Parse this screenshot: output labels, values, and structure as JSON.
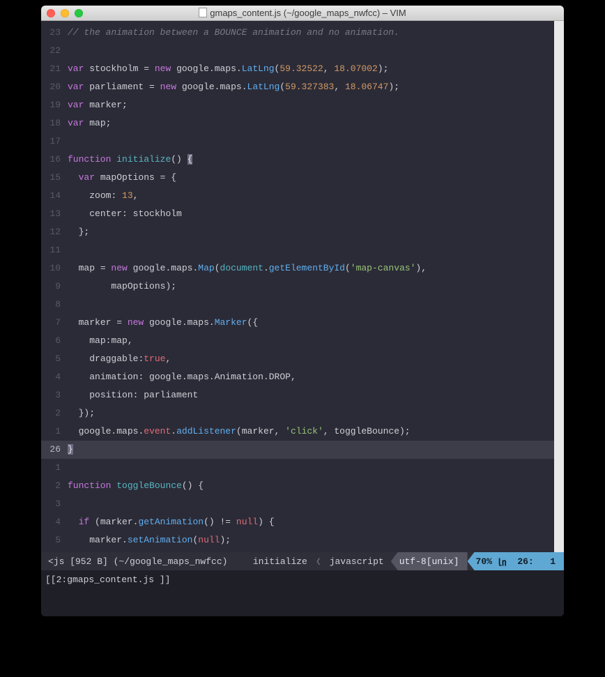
{
  "window": {
    "title": "gmaps_content.js (~/google_maps_nwfcc) – VIM"
  },
  "lines": [
    {
      "n": "23",
      "cur": false,
      "tokens": [
        {
          "c": "comment",
          "t": "// the animation between a BOUNCE animation and no animation."
        }
      ]
    },
    {
      "n": "22",
      "cur": false,
      "tokens": []
    },
    {
      "n": "21",
      "cur": false,
      "tokens": [
        {
          "c": "var",
          "t": "var"
        },
        {
          "c": "op",
          "t": " "
        },
        {
          "c": "ident",
          "t": "stockholm"
        },
        {
          "c": "op",
          "t": " = "
        },
        {
          "c": "new",
          "t": "new"
        },
        {
          "c": "op",
          "t": " "
        },
        {
          "c": "ident",
          "t": "google"
        },
        {
          "c": "dot",
          "t": "."
        },
        {
          "c": "ident",
          "t": "maps"
        },
        {
          "c": "dot",
          "t": "."
        },
        {
          "c": "fn",
          "t": "LatLng"
        },
        {
          "c": "op",
          "t": "("
        },
        {
          "c": "num",
          "t": "59.32522"
        },
        {
          "c": "op",
          "t": ", "
        },
        {
          "c": "num",
          "t": "18.07002"
        },
        {
          "c": "op",
          "t": ");"
        }
      ]
    },
    {
      "n": "20",
      "cur": false,
      "tokens": [
        {
          "c": "var",
          "t": "var"
        },
        {
          "c": "op",
          "t": " "
        },
        {
          "c": "ident",
          "t": "parliament"
        },
        {
          "c": "op",
          "t": " = "
        },
        {
          "c": "new",
          "t": "new"
        },
        {
          "c": "op",
          "t": " "
        },
        {
          "c": "ident",
          "t": "google"
        },
        {
          "c": "dot",
          "t": "."
        },
        {
          "c": "ident",
          "t": "maps"
        },
        {
          "c": "dot",
          "t": "."
        },
        {
          "c": "fn",
          "t": "LatLng"
        },
        {
          "c": "op",
          "t": "("
        },
        {
          "c": "num",
          "t": "59.327383"
        },
        {
          "c": "op",
          "t": ", "
        },
        {
          "c": "num",
          "t": "18.06747"
        },
        {
          "c": "op",
          "t": ");"
        }
      ]
    },
    {
      "n": "19",
      "cur": false,
      "tokens": [
        {
          "c": "var",
          "t": "var"
        },
        {
          "c": "op",
          "t": " "
        },
        {
          "c": "ident",
          "t": "marker"
        },
        {
          "c": "op",
          "t": ";"
        }
      ]
    },
    {
      "n": "18",
      "cur": false,
      "tokens": [
        {
          "c": "var",
          "t": "var"
        },
        {
          "c": "op",
          "t": " "
        },
        {
          "c": "ident",
          "t": "map"
        },
        {
          "c": "op",
          "t": ";"
        }
      ]
    },
    {
      "n": "17",
      "cur": false,
      "tokens": []
    },
    {
      "n": "16",
      "cur": false,
      "tokens": [
        {
          "c": "kw",
          "t": "function"
        },
        {
          "c": "op",
          "t": " "
        },
        {
          "c": "fname",
          "t": "initialize"
        },
        {
          "c": "op",
          "t": "() "
        },
        {
          "c": "brace-hl",
          "t": "{"
        }
      ]
    },
    {
      "n": "15",
      "cur": false,
      "tokens": [
        {
          "c": "op",
          "t": "  "
        },
        {
          "c": "var",
          "t": "var"
        },
        {
          "c": "op",
          "t": " "
        },
        {
          "c": "ident",
          "t": "mapOptions"
        },
        {
          "c": "op",
          "t": " = {"
        }
      ]
    },
    {
      "n": "14",
      "cur": false,
      "tokens": [
        {
          "c": "op",
          "t": "    "
        },
        {
          "c": "ident",
          "t": "zoom"
        },
        {
          "c": "op",
          "t": ": "
        },
        {
          "c": "num",
          "t": "13"
        },
        {
          "c": "op",
          "t": ","
        }
      ]
    },
    {
      "n": "13",
      "cur": false,
      "tokens": [
        {
          "c": "op",
          "t": "    "
        },
        {
          "c": "ident",
          "t": "center"
        },
        {
          "c": "op",
          "t": ": "
        },
        {
          "c": "ident",
          "t": "stockholm"
        }
      ]
    },
    {
      "n": "12",
      "cur": false,
      "tokens": [
        {
          "c": "op",
          "t": "  };"
        }
      ]
    },
    {
      "n": "11",
      "cur": false,
      "tokens": []
    },
    {
      "n": "10",
      "cur": false,
      "tokens": [
        {
          "c": "op",
          "t": "  "
        },
        {
          "c": "ident",
          "t": "map"
        },
        {
          "c": "op",
          "t": " = "
        },
        {
          "c": "new",
          "t": "new"
        },
        {
          "c": "op",
          "t": " "
        },
        {
          "c": "ident",
          "t": "google"
        },
        {
          "c": "dot",
          "t": "."
        },
        {
          "c": "ident",
          "t": "maps"
        },
        {
          "c": "dot",
          "t": "."
        },
        {
          "c": "fn",
          "t": "Map"
        },
        {
          "c": "op",
          "t": "("
        },
        {
          "c": "doc",
          "t": "document"
        },
        {
          "c": "dot",
          "t": "."
        },
        {
          "c": "fn",
          "t": "getElementById"
        },
        {
          "c": "op",
          "t": "("
        },
        {
          "c": "str",
          "t": "'map-canvas'"
        },
        {
          "c": "op",
          "t": "),"
        }
      ]
    },
    {
      "n": "9",
      "cur": false,
      "tokens": [
        {
          "c": "op",
          "t": "        "
        },
        {
          "c": "ident",
          "t": "mapOptions"
        },
        {
          "c": "op",
          "t": ");"
        }
      ]
    },
    {
      "n": "8",
      "cur": false,
      "tokens": []
    },
    {
      "n": "7",
      "cur": false,
      "tokens": [
        {
          "c": "op",
          "t": "  "
        },
        {
          "c": "ident",
          "t": "marker"
        },
        {
          "c": "op",
          "t": " = "
        },
        {
          "c": "new",
          "t": "new"
        },
        {
          "c": "op",
          "t": " "
        },
        {
          "c": "ident",
          "t": "google"
        },
        {
          "c": "dot",
          "t": "."
        },
        {
          "c": "ident",
          "t": "maps"
        },
        {
          "c": "dot",
          "t": "."
        },
        {
          "c": "fn",
          "t": "Marker"
        },
        {
          "c": "op",
          "t": "({"
        }
      ]
    },
    {
      "n": "6",
      "cur": false,
      "tokens": [
        {
          "c": "op",
          "t": "    "
        },
        {
          "c": "ident",
          "t": "map"
        },
        {
          "c": "op",
          "t": ":"
        },
        {
          "c": "ident",
          "t": "map"
        },
        {
          "c": "op",
          "t": ","
        }
      ]
    },
    {
      "n": "5",
      "cur": false,
      "tokens": [
        {
          "c": "op",
          "t": "    "
        },
        {
          "c": "ident",
          "t": "draggable"
        },
        {
          "c": "op",
          "t": ":"
        },
        {
          "c": "bool",
          "t": "true"
        },
        {
          "c": "op",
          "t": ","
        }
      ]
    },
    {
      "n": "4",
      "cur": false,
      "tokens": [
        {
          "c": "op",
          "t": "    "
        },
        {
          "c": "ident",
          "t": "animation"
        },
        {
          "c": "op",
          "t": ": "
        },
        {
          "c": "ident",
          "t": "google"
        },
        {
          "c": "dot",
          "t": "."
        },
        {
          "c": "ident",
          "t": "maps"
        },
        {
          "c": "dot",
          "t": "."
        },
        {
          "c": "ident",
          "t": "Animation"
        },
        {
          "c": "dot",
          "t": "."
        },
        {
          "c": "ident",
          "t": "DROP"
        },
        {
          "c": "op",
          "t": ","
        }
      ]
    },
    {
      "n": "3",
      "cur": false,
      "tokens": [
        {
          "c": "op",
          "t": "    "
        },
        {
          "c": "ident",
          "t": "position"
        },
        {
          "c": "op",
          "t": ": "
        },
        {
          "c": "ident",
          "t": "parliament"
        }
      ]
    },
    {
      "n": "2",
      "cur": false,
      "tokens": [
        {
          "c": "op",
          "t": "  });"
        }
      ]
    },
    {
      "n": "1",
      "cur": false,
      "tokens": [
        {
          "c": "op",
          "t": "  "
        },
        {
          "c": "ident",
          "t": "google"
        },
        {
          "c": "dot",
          "t": "."
        },
        {
          "c": "ident",
          "t": "maps"
        },
        {
          "c": "dot",
          "t": "."
        },
        {
          "c": "member",
          "t": "event"
        },
        {
          "c": "dot",
          "t": "."
        },
        {
          "c": "fn",
          "t": "addListener"
        },
        {
          "c": "op",
          "t": "("
        },
        {
          "c": "ident",
          "t": "marker"
        },
        {
          "c": "op",
          "t": ", "
        },
        {
          "c": "str",
          "t": "'click'"
        },
        {
          "c": "op",
          "t": ", "
        },
        {
          "c": "ident",
          "t": "toggleBounce"
        },
        {
          "c": "op",
          "t": ");"
        }
      ]
    },
    {
      "n": "26",
      "cur": true,
      "tokens": [
        {
          "c": "brace-hl",
          "t": "}"
        }
      ]
    },
    {
      "n": "1",
      "cur": false,
      "tokens": []
    },
    {
      "n": "2",
      "cur": false,
      "tokens": [
        {
          "c": "kw",
          "t": "function"
        },
        {
          "c": "op",
          "t": " "
        },
        {
          "c": "fname",
          "t": "toggleBounce"
        },
        {
          "c": "op",
          "t": "() {"
        }
      ]
    },
    {
      "n": "3",
      "cur": false,
      "tokens": []
    },
    {
      "n": "4",
      "cur": false,
      "tokens": [
        {
          "c": "op",
          "t": "  "
        },
        {
          "c": "kw",
          "t": "if"
        },
        {
          "c": "op",
          "t": " ("
        },
        {
          "c": "ident",
          "t": "marker"
        },
        {
          "c": "dot",
          "t": "."
        },
        {
          "c": "fn",
          "t": "getAnimation"
        },
        {
          "c": "op",
          "t": "() != "
        },
        {
          "c": "bool",
          "t": "null"
        },
        {
          "c": "op",
          "t": ") {"
        }
      ]
    },
    {
      "n": "5",
      "cur": false,
      "tokens": [
        {
          "c": "op",
          "t": "    "
        },
        {
          "c": "ident",
          "t": "marker"
        },
        {
          "c": "dot",
          "t": "."
        },
        {
          "c": "fn",
          "t": "setAnimation"
        },
        {
          "c": "op",
          "t": "("
        },
        {
          "c": "bool",
          "t": "null"
        },
        {
          "c": "op",
          "t": ");"
        }
      ]
    }
  ],
  "status": {
    "fileinfo": "<js [952 B] (~/google_maps_nwfcc)",
    "funcname": "initialize",
    "filetype": "javascript",
    "encoding": "utf-8[unix]",
    "percent": "70%",
    "lnsym": "㏑",
    "line": "26:",
    "col": "1"
  },
  "tabline": "[[2:gmaps_content.js ]]"
}
